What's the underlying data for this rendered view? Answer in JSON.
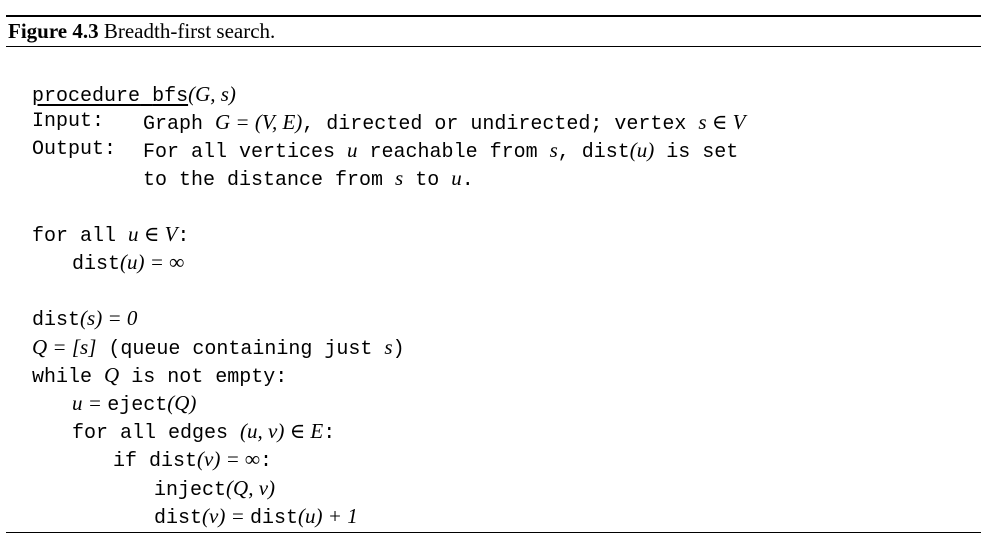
{
  "figure": {
    "label": "Figure 4.3",
    "title": " Breadth-first search."
  },
  "header": {
    "procedure_kw": "procedure",
    "procedure_name": "bfs",
    "procedure_args": "(G, s)",
    "input_label": "Input:",
    "input_text_1": "Graph ",
    "input_math": "G = (V, E)",
    "input_text_2": ", directed or undirected; vertex ",
    "input_math_2": "s ∈ V",
    "output_label": "Output:",
    "output_text_1": "For all vertices ",
    "output_u": "u",
    "output_text_2": " reachable from ",
    "output_s": "s",
    "output_text_3": ", dist",
    "output_paren_u": "(u)",
    "output_text_4": " is set",
    "output_line2_a": "to the distance from ",
    "output_line2_s": "s",
    "output_line2_b": " to ",
    "output_line2_u": "u",
    "output_line2_c": "."
  },
  "code": {
    "l1_kw": "for all ",
    "l1_m": "u ∈ V",
    "l1_end": ":",
    "l2_a": "dist",
    "l2_m": "(u) = ∞",
    "l3_a": "dist",
    "l3_m": "(s) = 0",
    "l4_m": "Q = [s]",
    "l4_t": " (queue containing just ",
    "l4_s": "s",
    "l4_e": ")",
    "l5_a": "while ",
    "l5_m": "Q",
    "l5_b": " is not empty:",
    "l6_m1": "u = ",
    "l6_a": "eject",
    "l6_m2": "(Q)",
    "l7_a": "for all edges ",
    "l7_m": "(u, v) ∈ E",
    "l7_b": ":",
    "l8_a": "if dist",
    "l8_m": "(v) = ∞",
    "l8_b": ":",
    "l9_a": "inject",
    "l9_m": "(Q, v)",
    "l10_a": "dist",
    "l10_m1": "(v) = ",
    "l10_b": "dist",
    "l10_m2": "(u) + 1"
  }
}
